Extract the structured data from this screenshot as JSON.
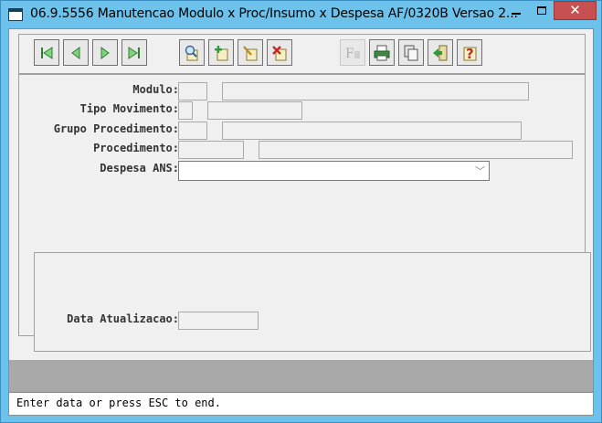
{
  "window": {
    "title": "06.9.5556 Manutencao  Modulo x Proc/Insumo x Despesa AF/0320B Versao 2...",
    "controls": [
      "minimize",
      "maximize",
      "close"
    ]
  },
  "toolbar": {
    "buttons": [
      {
        "name": "first-record",
        "icon": "first-icon",
        "enabled": true
      },
      {
        "name": "previous-record",
        "icon": "previous-icon",
        "enabled": true
      },
      {
        "name": "next-record",
        "icon": "next-icon",
        "enabled": true
      },
      {
        "name": "last-record",
        "icon": "last-icon",
        "enabled": true
      },
      {
        "name": "search",
        "icon": "magnifier-icon",
        "enabled": true
      },
      {
        "name": "add",
        "icon": "add-icon",
        "enabled": true
      },
      {
        "name": "edit",
        "icon": "edit-icon",
        "enabled": true
      },
      {
        "name": "delete",
        "icon": "delete-icon",
        "enabled": true
      },
      {
        "name": "filter",
        "icon": "filter-icon",
        "enabled": false
      },
      {
        "name": "print",
        "icon": "printer-icon",
        "enabled": true
      },
      {
        "name": "copy",
        "icon": "copy-icon",
        "enabled": true
      },
      {
        "name": "exit",
        "icon": "exit-icon",
        "enabled": true
      },
      {
        "name": "help",
        "icon": "help-icon",
        "enabled": true
      }
    ]
  },
  "form": {
    "modulo_label": "Modulo:",
    "tipo_movimento_label": "Tipo Movimento:",
    "grupo_procedimento_label": "Grupo Procedimento:",
    "procedimento_label": "Procedimento:",
    "despesa_ans_label": "Despesa ANS:",
    "data_atualizacao_label": "Data Atualizacao:",
    "modulo_code": "",
    "modulo_desc": "",
    "tipo_movimento_code": "",
    "tipo_movimento_desc": "",
    "grupo_procedimento_code": "",
    "grupo_procedimento_desc": "",
    "procedimento_code": "",
    "procedimento_desc": "",
    "despesa_ans_value": "",
    "data_atualizacao_value": ""
  },
  "status": {
    "message": "Enter data or press ESC to end."
  },
  "colors": {
    "titlebar": "#6cc2eb",
    "client": "#f0f0f0",
    "close_button": "#c75050",
    "status_gray": "#a9a9a9"
  }
}
